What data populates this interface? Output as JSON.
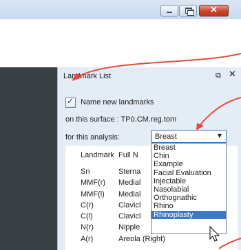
{
  "panel": {
    "title": "Landmark List",
    "name_new_landmarks_label": "Name new landmarks",
    "name_new_landmarks_checked": true,
    "surface_line": "on this surface : TP0.CM.reg.tom",
    "analysis_label": "for this analysis:",
    "analysis_selected": "Breast"
  },
  "list": {
    "headers": [
      "Landmark",
      "Full N"
    ],
    "rows": [
      {
        "landmark": "Sn",
        "full_name": "Sterna"
      },
      {
        "landmark": "MMF(r)",
        "full_name": "Medial"
      },
      {
        "landmark": "MMF(l)",
        "full_name": "Medial"
      },
      {
        "landmark": "C(r)",
        "full_name": "Clavicl"
      },
      {
        "landmark": "C(l)",
        "full_name": "Clavicl"
      },
      {
        "landmark": "N(r)",
        "full_name": "Nipple"
      },
      {
        "landmark": "A(r)",
        "full_name": "Areola (Right)"
      }
    ]
  },
  "dropdown": {
    "options": [
      "Breast",
      "Chin",
      "Example",
      "Facial Evaluation",
      "Injectable",
      "Nasolabial",
      "Orthognathic",
      "Rhino",
      "Rhinoplasty"
    ],
    "highlighted": "Rhinoplasty"
  },
  "window_buttons": {
    "minimize_icon": "minimize-icon",
    "maximize_icon": "restore-icon",
    "close_icon": "close-icon"
  },
  "colors": {
    "annotation_arrows": "#e8473a",
    "selection": "#3a78c9",
    "panel_bg": "#e4ecf6",
    "dark_pane": "#3a3f44"
  }
}
